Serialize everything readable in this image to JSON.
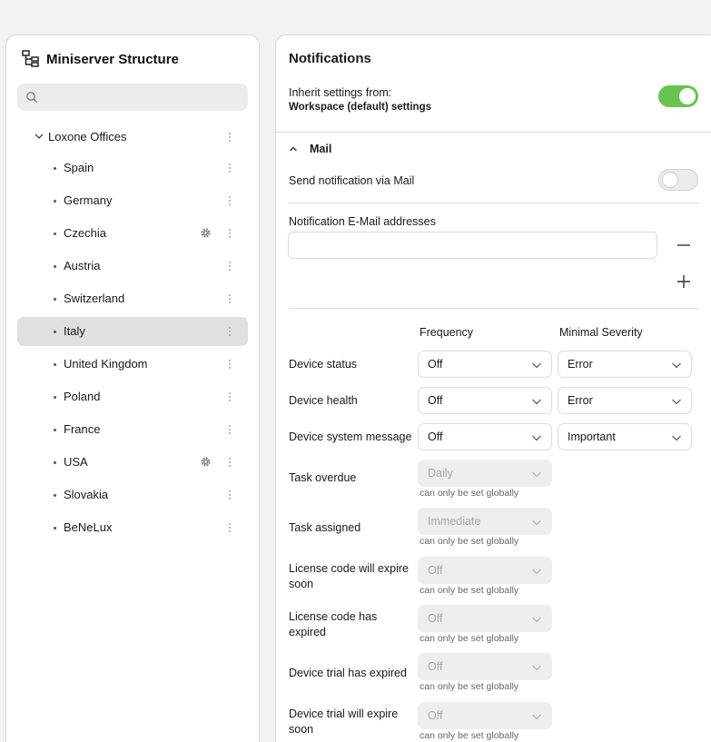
{
  "structure": {
    "title": "Miniserver Structure",
    "search": {
      "placeholder": ""
    },
    "root": {
      "label": "Loxone Offices"
    },
    "items": [
      {
        "label": "Spain",
        "has_gear": false,
        "selected": false
      },
      {
        "label": "Germany",
        "has_gear": false,
        "selected": false
      },
      {
        "label": "Czechia",
        "has_gear": true,
        "selected": false
      },
      {
        "label": "Austria",
        "has_gear": false,
        "selected": false
      },
      {
        "label": "Switzerland",
        "has_gear": false,
        "selected": false
      },
      {
        "label": "Italy",
        "has_gear": false,
        "selected": true
      },
      {
        "label": "United Kingdom",
        "has_gear": false,
        "selected": false
      },
      {
        "label": "Poland",
        "has_gear": false,
        "selected": false
      },
      {
        "label": "France",
        "has_gear": false,
        "selected": false
      },
      {
        "label": "USA",
        "has_gear": true,
        "selected": false
      },
      {
        "label": "Slovakia",
        "has_gear": false,
        "selected": false
      },
      {
        "label": "BeNeLux",
        "has_gear": false,
        "selected": false
      }
    ]
  },
  "notifications": {
    "title": "Notifications",
    "inherit_label": "Inherit settings from:",
    "inherit_value": "Workspace (default) settings",
    "inherit_enabled": true,
    "mail": {
      "section_label": "Mail",
      "send_label": "Send notification via Mail",
      "send_enabled": false,
      "addresses_label": "Notification E-Mail addresses",
      "address_value": ""
    },
    "columns": {
      "frequency": "Frequency",
      "severity": "Minimal Severity"
    },
    "rows": [
      {
        "label": "Device status",
        "frequency": "Off",
        "severity": "Error",
        "global_only": false
      },
      {
        "label": "Device health",
        "frequency": "Off",
        "severity": "Error",
        "global_only": false
      },
      {
        "label": "Device system message",
        "frequency": "Off",
        "severity": "Important",
        "global_only": false
      },
      {
        "label": "Task overdue",
        "frequency": "Daily",
        "global_only": true,
        "note": "can only be set globally"
      },
      {
        "label": "Task assigned",
        "frequency": "Immediate",
        "global_only": true,
        "note": "can only be set globally"
      },
      {
        "label": "License code will expire soon",
        "frequency": "Off",
        "global_only": true,
        "note": "can only be set globally"
      },
      {
        "label": "License code has expired",
        "frequency": "Off",
        "global_only": true,
        "note": "can only be set globally"
      },
      {
        "label": "Device trial has expired",
        "frequency": "Off",
        "global_only": true,
        "note": "can only be set globally"
      },
      {
        "label": "Device trial will expire soon",
        "frequency": "Off",
        "global_only": true,
        "note": "can only be set globally"
      }
    ]
  },
  "colors": {
    "toggle_on": "#69c350",
    "selected_row": "#e0e0e0",
    "panel_border": "#dadada"
  }
}
